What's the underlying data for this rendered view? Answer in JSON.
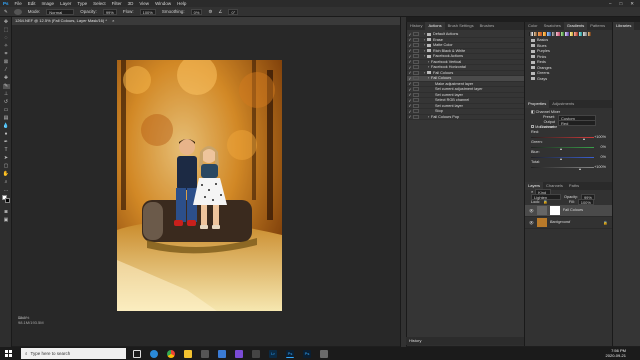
{
  "app": {
    "title_tab": "1264.NEF @ 12.5% (Fall Colours, Layer Mask/16) *"
  },
  "menu": [
    "File",
    "Edit",
    "Image",
    "Layer",
    "Type",
    "Select",
    "Filter",
    "3D",
    "View",
    "Window",
    "Help"
  ],
  "options_bar": {
    "mode_label": "Mode:",
    "mode_value": "Normal",
    "opacity_label": "Opacity:",
    "opacity_value": "99%",
    "flow_label": "Flow:",
    "flow_value": "100%",
    "smoothing_label": "Smoothing:",
    "smoothing_value": "0%",
    "angle_value": "0°"
  },
  "status_bar": {
    "zoom": "12.5%",
    "doc_size": "Doc: 98.1M/193.5M"
  },
  "actions_panel": {
    "tabs": [
      "History",
      "Actions",
      "Brush Settings",
      "Brushes"
    ],
    "rows": [
      {
        "label": "Default Actions",
        "indent": 1,
        "check": "✓"
      },
      {
        "label": "Erase",
        "indent": 1,
        "check": "✓"
      },
      {
        "label": "Matte Color",
        "indent": 1,
        "check": "✓"
      },
      {
        "label": "Rich Black & White",
        "indent": 1,
        "check": "✓"
      },
      {
        "label": "Facebook Actions",
        "indent": 1,
        "check": "✓"
      },
      {
        "label": "Facebook Vertical",
        "indent": 2,
        "check": "✓"
      },
      {
        "label": "Facebook Horizontal",
        "indent": 2,
        "check": "✓"
      },
      {
        "label": "Fall Colours",
        "indent": 1,
        "check": "✓"
      },
      {
        "label": "Fall Colours",
        "indent": 2,
        "check": "✓",
        "highlight": true
      },
      {
        "label": "Make adjustment layer",
        "indent": 3,
        "check": "✓"
      },
      {
        "label": "Set current adjustment layer",
        "indent": 3,
        "check": "✓"
      },
      {
        "label": "Set current layer",
        "indent": 3,
        "check": "✓"
      },
      {
        "label": "Select RGB channel",
        "indent": 3,
        "check": "✓"
      },
      {
        "label": "Set current layer",
        "indent": 3,
        "check": "✓"
      },
      {
        "label": "Stop",
        "indent": 3,
        "check": "✓"
      },
      {
        "label": "Fall Colours Pop",
        "indent": 2,
        "check": "✓"
      }
    ],
    "history_label": "History"
  },
  "right_panel": {
    "top_tabs": [
      "Color",
      "Swatches",
      "Gradients",
      "Patterns"
    ],
    "lib_tab": "Libraries",
    "folders": [
      "Basics",
      "Blues",
      "Purples",
      "Pinks",
      "Reds",
      "Oranges",
      "Greens",
      "Grays"
    ],
    "properties_tabs": [
      "Properties",
      "Adjustments"
    ],
    "properties_title": "Channel Mixer",
    "preset_label": "Preset:",
    "preset_value": "Custom",
    "output_label": "Output Channel:",
    "output_value": "Red",
    "monochrome_label": "Monochrome",
    "sliders": [
      {
        "label": "Red:",
        "value": "+100%",
        "pct": 0.85,
        "color": "#d23a3a"
      },
      {
        "label": "Green:",
        "value": "0%",
        "pct": 0.55,
        "color": "#3aa04a"
      },
      {
        "label": "Blue:",
        "value": "0%",
        "pct": 0.55,
        "color": "#3a5fd2"
      },
      {
        "label": "Total:",
        "value": "+100%",
        "pct": 0.8,
        "color": "#888888"
      }
    ],
    "layers_tabs": [
      "Layers",
      "Channels",
      "Paths"
    ],
    "blend_label": "Lighten",
    "opacity_label": "Opacity:",
    "opacity_value": "99%",
    "fill_label": "Fill:",
    "fill_value": "100%",
    "lock_label": "Lock:",
    "kind_label": "Kind",
    "layers": [
      {
        "name": "Fall Colours"
      },
      {
        "name": "Background"
      }
    ]
  },
  "taskbar": {
    "search_placeholder": "Type here to search",
    "time": "7:56 PM",
    "date": "2020-09-21"
  },
  "colors": {
    "ps_bg": "#1e1e1e",
    "panel": "#353535",
    "highlight": "#4a4a4a",
    "accent_blue": "#31a8ff"
  }
}
